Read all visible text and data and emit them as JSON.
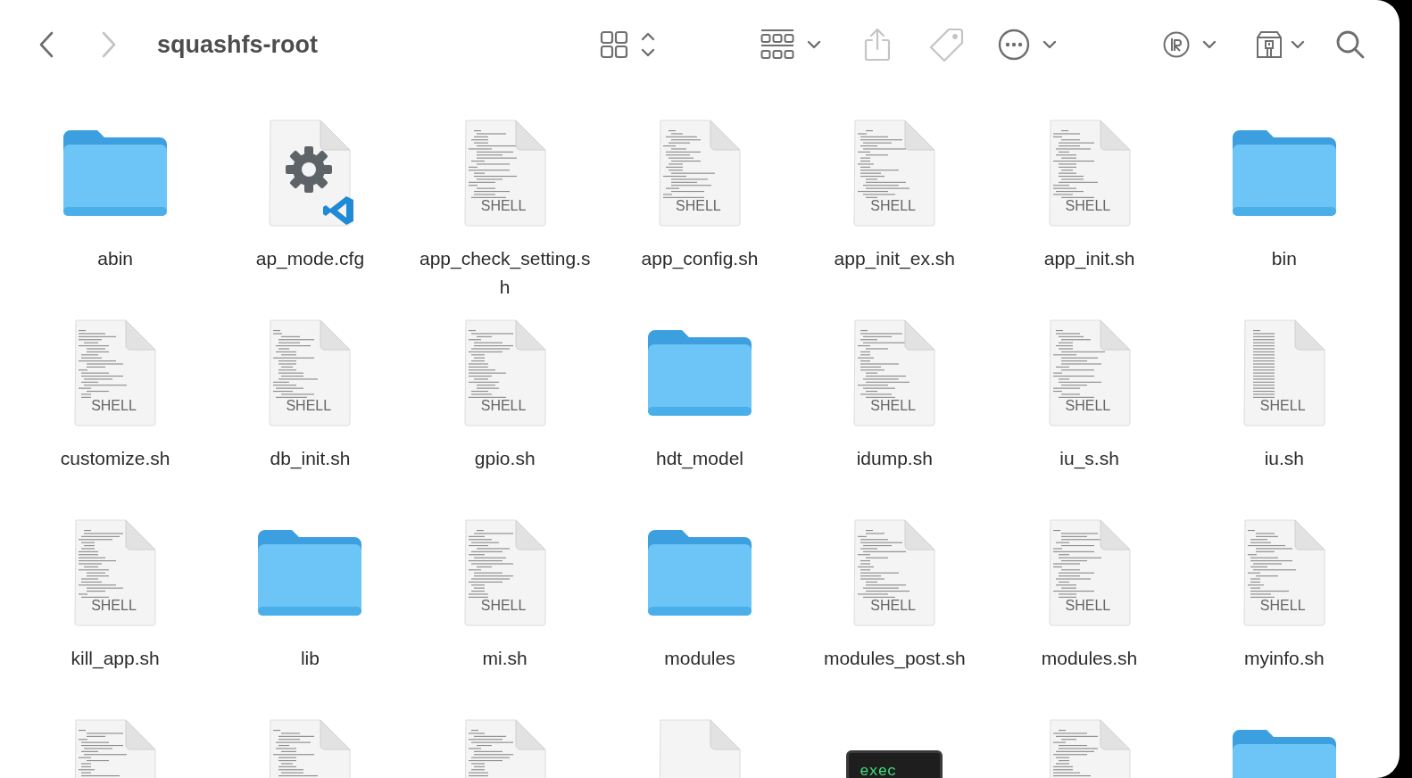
{
  "window": {
    "title": "squashfs-root"
  },
  "toolbar": [
    {
      "kind": "back",
      "disabled": false
    },
    {
      "kind": "forward",
      "disabled": true
    },
    {
      "kind": "view",
      "disabled": false
    },
    {
      "kind": "group",
      "disabled": false
    },
    {
      "kind": "share",
      "disabled": true
    },
    {
      "kind": "tag",
      "disabled": true
    },
    {
      "kind": "more",
      "disabled": false
    },
    {
      "kind": "r-ext",
      "disabled": false
    },
    {
      "kind": "box-ext",
      "disabled": false
    },
    {
      "kind": "search",
      "disabled": false
    }
  ],
  "files": [
    {
      "kind": "folder",
      "name": "abin"
    },
    {
      "kind": "config",
      "name": "ap_mode.cfg"
    },
    {
      "kind": "shell",
      "badge": "SHELL",
      "name": "app_check_setting.sh"
    },
    {
      "kind": "shell",
      "badge": "SHELL",
      "name": "app_config.sh"
    },
    {
      "kind": "shell",
      "badge": "SHELL",
      "name": "app_init_ex.sh"
    },
    {
      "kind": "shell",
      "badge": "SHELL",
      "name": "app_init.sh"
    },
    {
      "kind": "folder",
      "name": "bin"
    },
    {
      "kind": "shell",
      "badge": "SHELL",
      "name": "customize.sh"
    },
    {
      "kind": "shell",
      "badge": "SHELL",
      "name": "db_init.sh"
    },
    {
      "kind": "shell",
      "badge": "SHELL",
      "name": "gpio.sh"
    },
    {
      "kind": "folder",
      "name": "hdt_model"
    },
    {
      "kind": "shell",
      "badge": "SHELL",
      "name": "idump.sh"
    },
    {
      "kind": "shell",
      "badge": "SHELL",
      "name": "iu_s.sh"
    },
    {
      "kind": "shell",
      "badge": "SHELL",
      "name": "iu.sh"
    },
    {
      "kind": "shell",
      "badge": "SHELL",
      "name": "kill_app.sh"
    },
    {
      "kind": "folder",
      "name": "lib"
    },
    {
      "kind": "shell",
      "badge": "SHELL",
      "name": "mi.sh"
    },
    {
      "kind": "folder",
      "name": "modules"
    },
    {
      "kind": "shell",
      "badge": "SHELL",
      "name": "modules_post.sh"
    },
    {
      "kind": "shell",
      "badge": "SHELL",
      "name": "modules.sh"
    },
    {
      "kind": "shell",
      "badge": "SHELL",
      "name": "myinfo.sh"
    },
    {
      "kind": "shell"
    },
    {
      "kind": "shell"
    },
    {
      "kind": "shell"
    },
    {
      "kind": "blank"
    },
    {
      "kind": "exec",
      "badge": "exec"
    },
    {
      "kind": "shell"
    },
    {
      "kind": "folder"
    }
  ]
}
